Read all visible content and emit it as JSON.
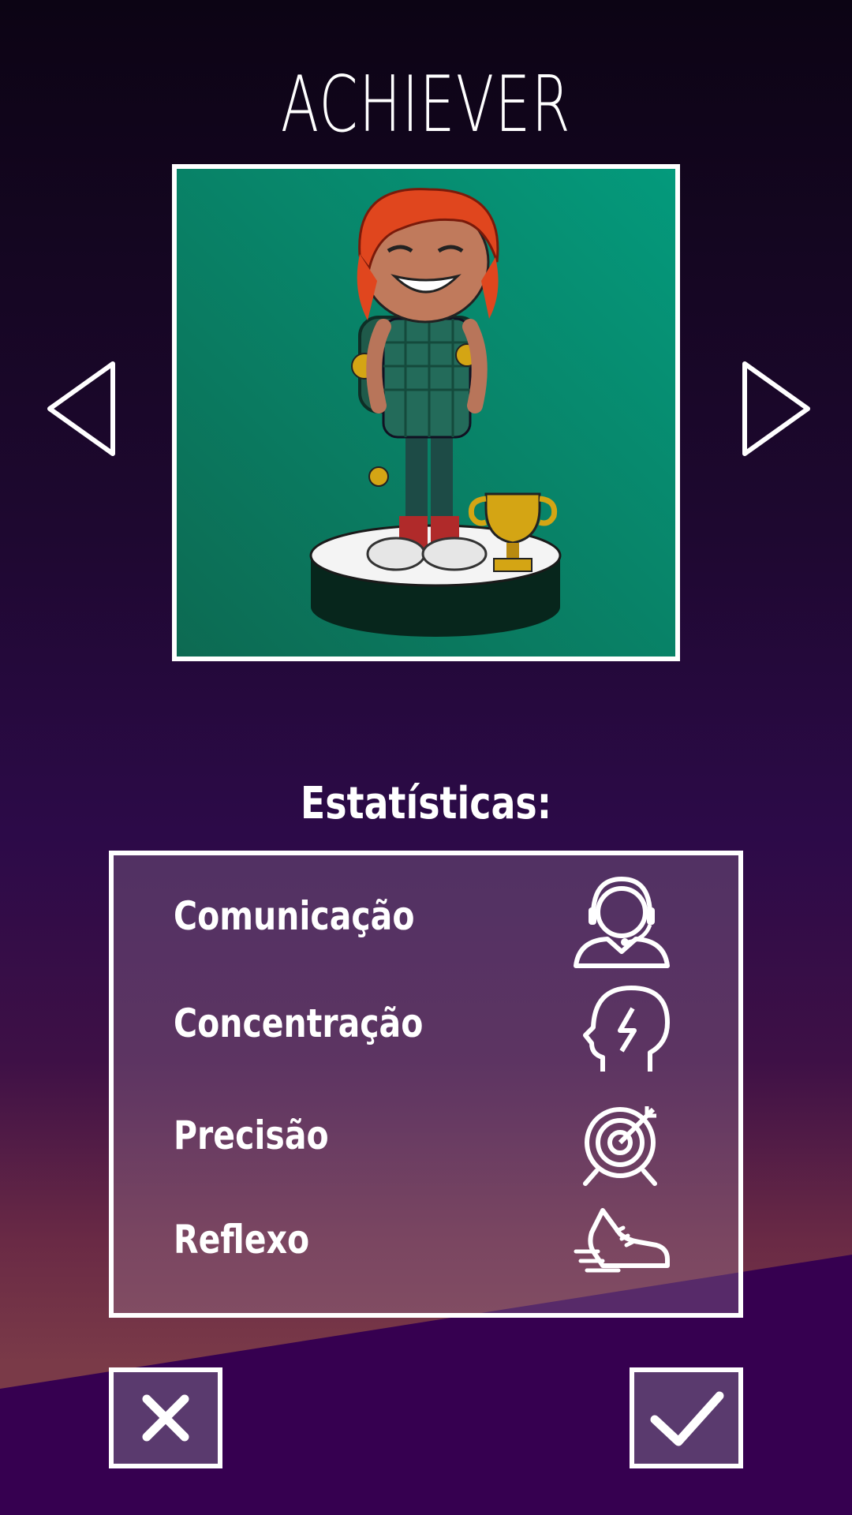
{
  "character": {
    "name": "ACHIEVER"
  },
  "stats": {
    "title": "Estatísticas:",
    "items": [
      {
        "label": "Comunicação",
        "icon": "headset-person-icon"
      },
      {
        "label": "Concentração",
        "icon": "head-lightning-icon"
      },
      {
        "label": "Precisão",
        "icon": "target-icon"
      },
      {
        "label": "Reflexo",
        "icon": "sneaker-icon"
      }
    ]
  },
  "navigation": {
    "previous": "previous-arrow-icon",
    "next": "next-arrow-icon"
  },
  "actions": {
    "cancel": "close-icon",
    "confirm": "checkmark-icon"
  },
  "colors": {
    "accent": "#ffffff",
    "portrait_bg": "#0a8a6a",
    "bg_top": "#0c0414",
    "bg_mid": "#2a0a44",
    "bg_bottom": "#360050"
  }
}
